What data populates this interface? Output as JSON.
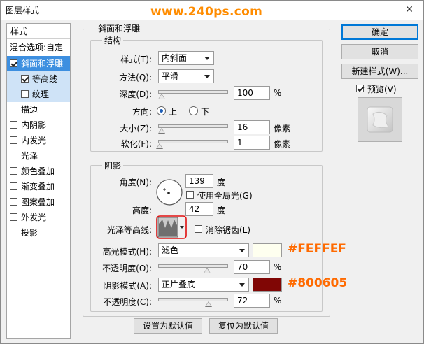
{
  "window": {
    "title": "图层样式",
    "watermark": "www.240ps.com",
    "close_glyph": "✕"
  },
  "style_list": {
    "header": "样式",
    "blend_options": "混合选项:自定",
    "items": [
      {
        "label": "斜面和浮雕",
        "checked": true,
        "selected": true
      },
      {
        "label": "等高线",
        "checked": true,
        "sub": true
      },
      {
        "label": "纹理",
        "checked": false,
        "sub": true
      },
      {
        "label": "描边",
        "checked": false
      },
      {
        "label": "内阴影",
        "checked": false
      },
      {
        "label": "内发光",
        "checked": false
      },
      {
        "label": "光泽",
        "checked": false
      },
      {
        "label": "颜色叠加",
        "checked": false
      },
      {
        "label": "渐变叠加",
        "checked": false
      },
      {
        "label": "图案叠加",
        "checked": false
      },
      {
        "label": "外发光",
        "checked": false
      },
      {
        "label": "投影",
        "checked": false
      }
    ]
  },
  "bevel": {
    "group_title": "斜面和浮雕",
    "structure_title": "结构",
    "style_label": "样式(T):",
    "style_value": "内斜面",
    "technique_label": "方法(Q):",
    "technique_value": "平滑",
    "depth_label": "深度(D):",
    "depth_value": "100",
    "depth_level": 0.04,
    "percent": "%",
    "direction_label": "方向:",
    "up_label": "上",
    "down_label": "下",
    "size_label": "大小(Z):",
    "size_value": "16",
    "size_level": 0.04,
    "soften_label": "软化(F):",
    "soften_value": "1",
    "soften_level": 0.01,
    "px_unit": "像素"
  },
  "shading": {
    "group_title": "阴影",
    "angle_label": "角度(N):",
    "angle_value": "139",
    "degree": "度",
    "global_light_label": "使用全局光(G)",
    "altitude_label": "高度:",
    "altitude_value": "42",
    "gloss_label": "光泽等高线:",
    "antialias_label": "消除锯齿(L)",
    "highlight_label": "高光模式(H):",
    "highlight_value": "滤色",
    "highlight_color": "#FEFFEF",
    "highlight_hex_text": "#FEFFEF",
    "highlight_opacity_label": "不透明度(O):",
    "highlight_opacity_value": "70",
    "highlight_opacity_level": 0.7,
    "shadow_label": "阴影模式(A):",
    "shadow_value": "正片叠底",
    "shadow_color": "#800605",
    "shadow_hex_text": "#800605",
    "shadow_opacity_label": "不透明度(C):",
    "shadow_opacity_value": "72",
    "shadow_opacity_level": 0.72,
    "hex_text_color": "#ff6a00"
  },
  "footer": {
    "set_default": "设置为默认值",
    "reset_default": "复位为默认值"
  },
  "actions": {
    "ok": "确定",
    "cancel": "取消",
    "new_style": "新建样式(W)...",
    "preview_label": "预览(V)",
    "preview_checked": true
  }
}
